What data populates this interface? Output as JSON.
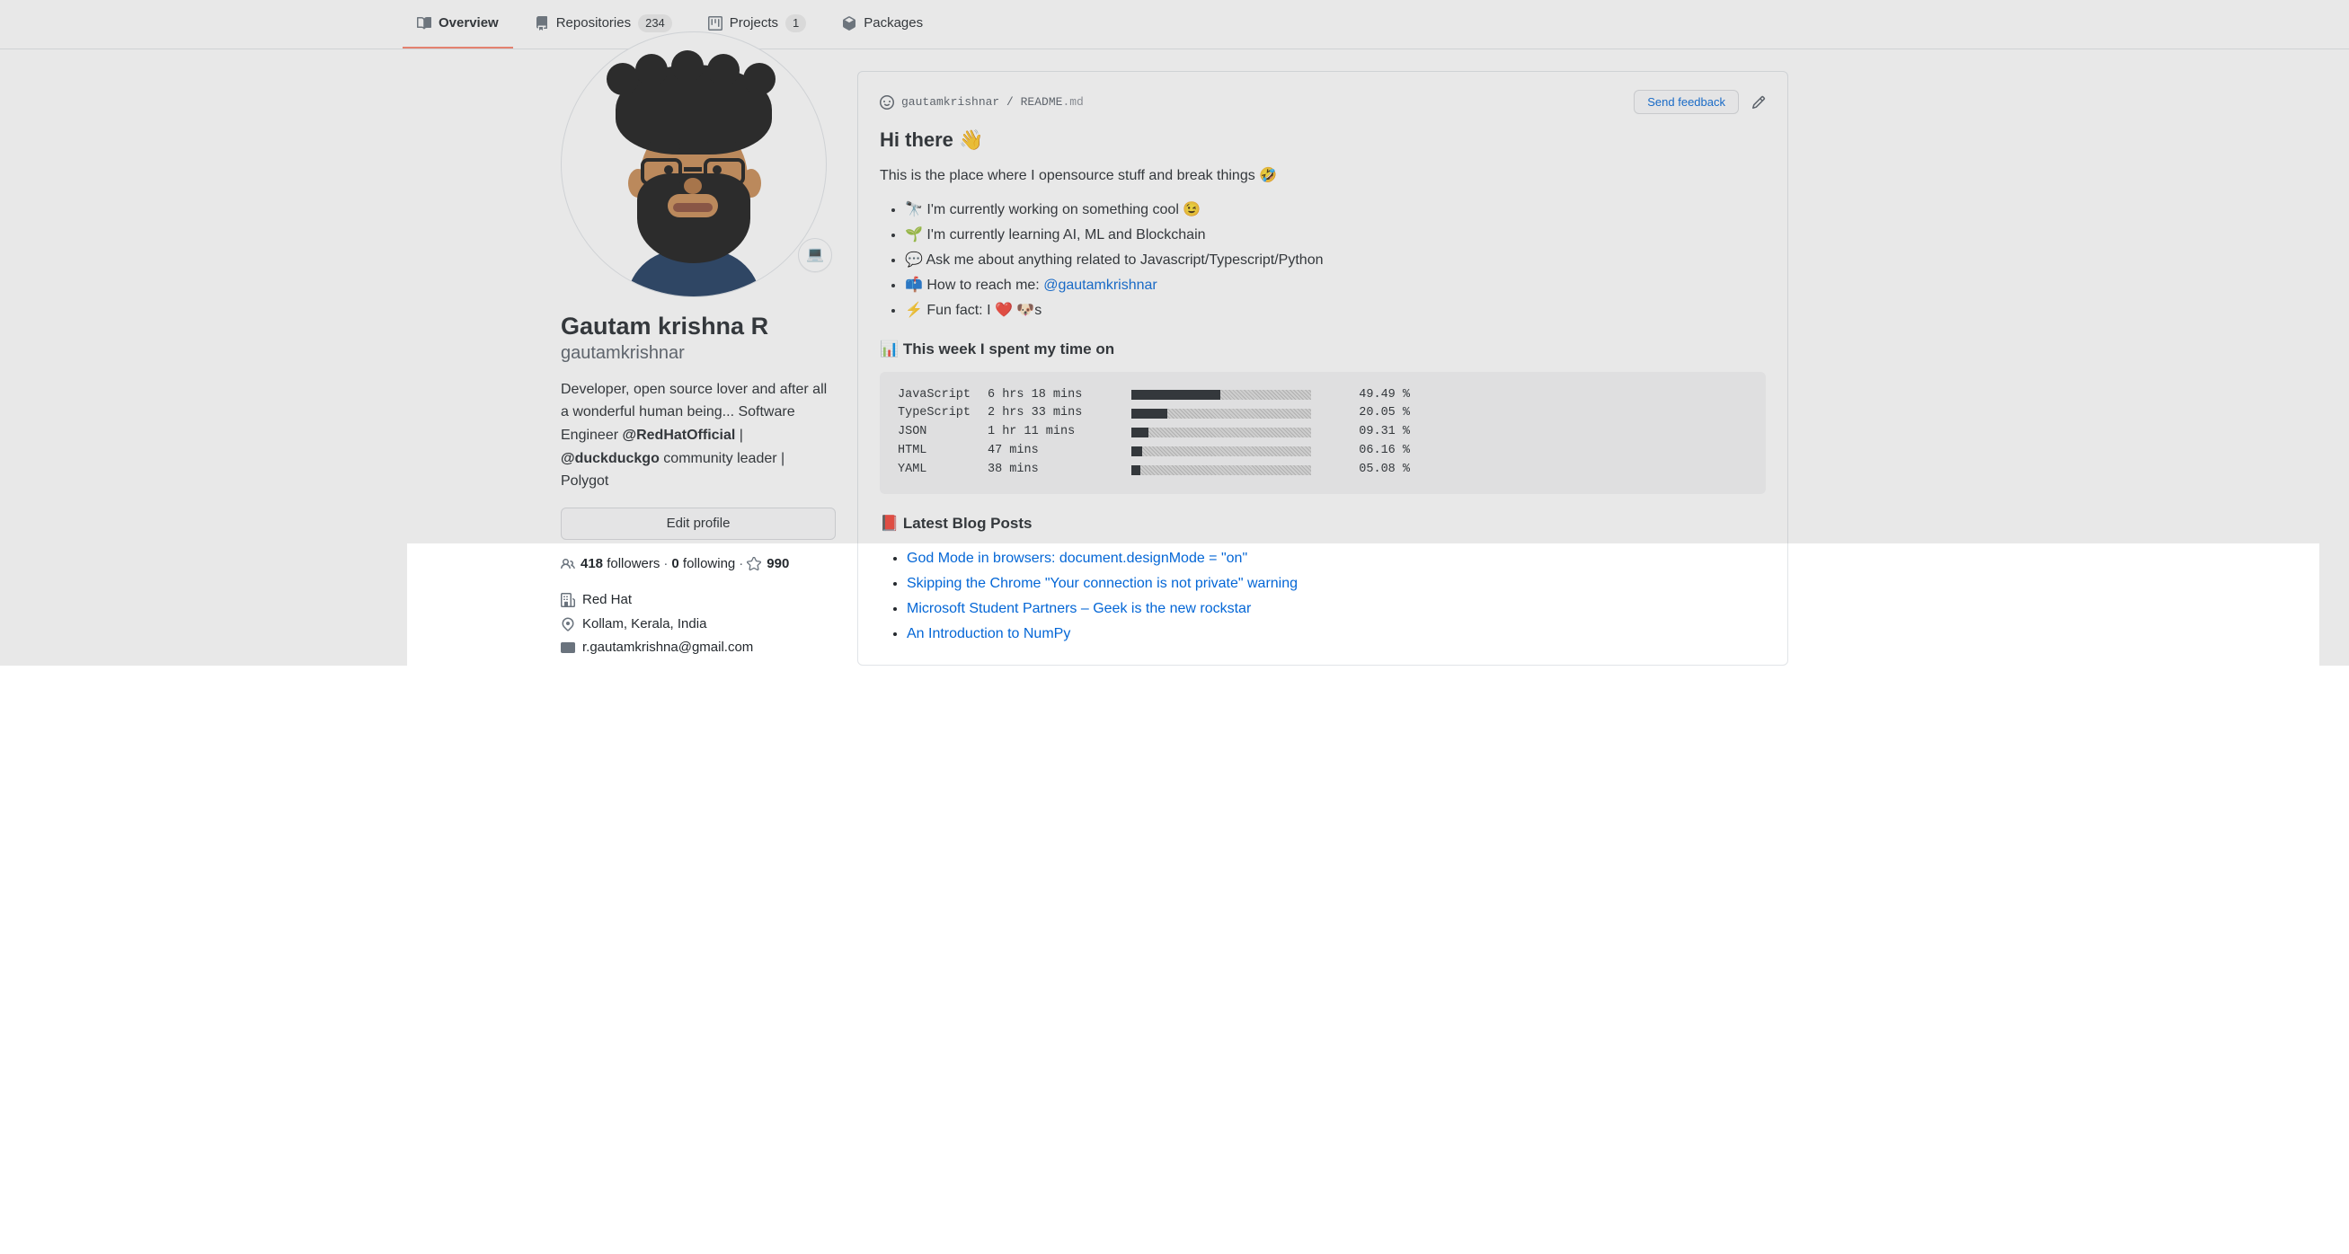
{
  "tabs": {
    "overview": "Overview",
    "repositories": "Repositories",
    "repositories_count": "234",
    "projects": "Projects",
    "projects_count": "1",
    "packages": "Packages"
  },
  "profile": {
    "display_name": "Gautam krishna R",
    "username": "gautamkrishnar",
    "status_emoji": "💻",
    "bio_pre": "Developer, open source lover and after all a wonderful human being... Software Engineer ",
    "bio_link1": "@RedHatOfficial",
    "bio_mid": " | ",
    "bio_link2": "@duckduckgo",
    "bio_post": " community leader | Polygot",
    "edit_label": "Edit profile",
    "followers_count": "418",
    "followers_label": " followers",
    "following_count": "0",
    "following_label": " following",
    "stars_count": "990",
    "company": "Red Hat",
    "location": "Kollam, Kerala, India",
    "email": "r.gautamkrishna@gmail.com"
  },
  "readme": {
    "user": "gautamkrishnar",
    "file": "README",
    "ext": ".md",
    "feedback_label": "Send feedback",
    "heading": "Hi there 👋",
    "intro": "This is the place where I opensource stuff and break things 🤣",
    "bullets": [
      "🔭  I'm currently working on something cool 😉",
      "🌱  I'm currently learning AI, ML and Blockchain",
      "💬  Ask me about anything related to Javascript/Typescript/Python"
    ],
    "bullet_contact_pre": "📫  How to reach me: ",
    "bullet_contact_link": "@gautamkrishnar",
    "bullet_fun": "⚡  Fun fact: I ❤️ 🐶s",
    "time_heading": "📊  This week I spent my time on",
    "blog_heading": "📕  Latest Blog Posts",
    "blog_posts": [
      "God Mode in browsers: document.designMode = \"on\"",
      "Skipping the Chrome \"Your connection is not private\" warning",
      "Microsoft Student Partners – Geek is the new rockstar",
      "An Introduction to NumPy"
    ]
  },
  "chart_data": {
    "type": "bar",
    "title": "This week I spent my time on",
    "series": [
      {
        "lang": "JavaScript",
        "time": "6 hrs 18 mins",
        "pct": 49.49
      },
      {
        "lang": "TypeScript",
        "time": "2 hrs 33 mins",
        "pct": 20.05
      },
      {
        "lang": "JSON",
        "time": "1 hr 11 mins",
        "pct": 9.31
      },
      {
        "lang": "HTML",
        "time": "47 mins",
        "pct": 6.16
      },
      {
        "lang": "YAML",
        "time": "38 mins",
        "pct": 5.08
      }
    ],
    "xlabel": "",
    "ylabel": "percent",
    "ylim": [
      0,
      50
    ]
  }
}
